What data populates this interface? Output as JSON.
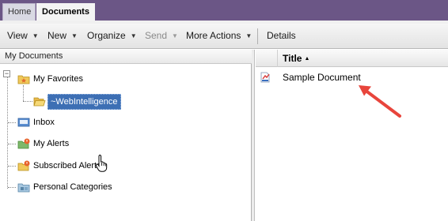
{
  "tabs": [
    {
      "label": "Home"
    },
    {
      "label": "Documents"
    }
  ],
  "toolbar": {
    "view": "View",
    "new": "New",
    "organize": "Organize",
    "send": "Send",
    "more_actions": "More Actions",
    "details": "Details"
  },
  "left_panel": {
    "header": "My Documents",
    "tree": [
      {
        "label": "My Favorites",
        "icon": "favorites-folder-icon"
      },
      {
        "label": "~WebIntelligence",
        "icon": "open-folder-icon",
        "selected": true
      },
      {
        "label": "Inbox",
        "icon": "inbox-icon"
      },
      {
        "label": "My Alerts",
        "icon": "alerts-icon"
      },
      {
        "label": "Subscribed Alerts",
        "icon": "subscribed-alerts-icon"
      },
      {
        "label": "Personal Categories",
        "icon": "categories-icon"
      }
    ]
  },
  "right_panel": {
    "column_title": "Title",
    "documents": [
      {
        "name": "Sample Document",
        "icon": "webi-document-icon"
      }
    ]
  },
  "colors": {
    "tabbar": "#6b5686",
    "selection": "#3d6fb4",
    "arrow": "#e8453c"
  }
}
